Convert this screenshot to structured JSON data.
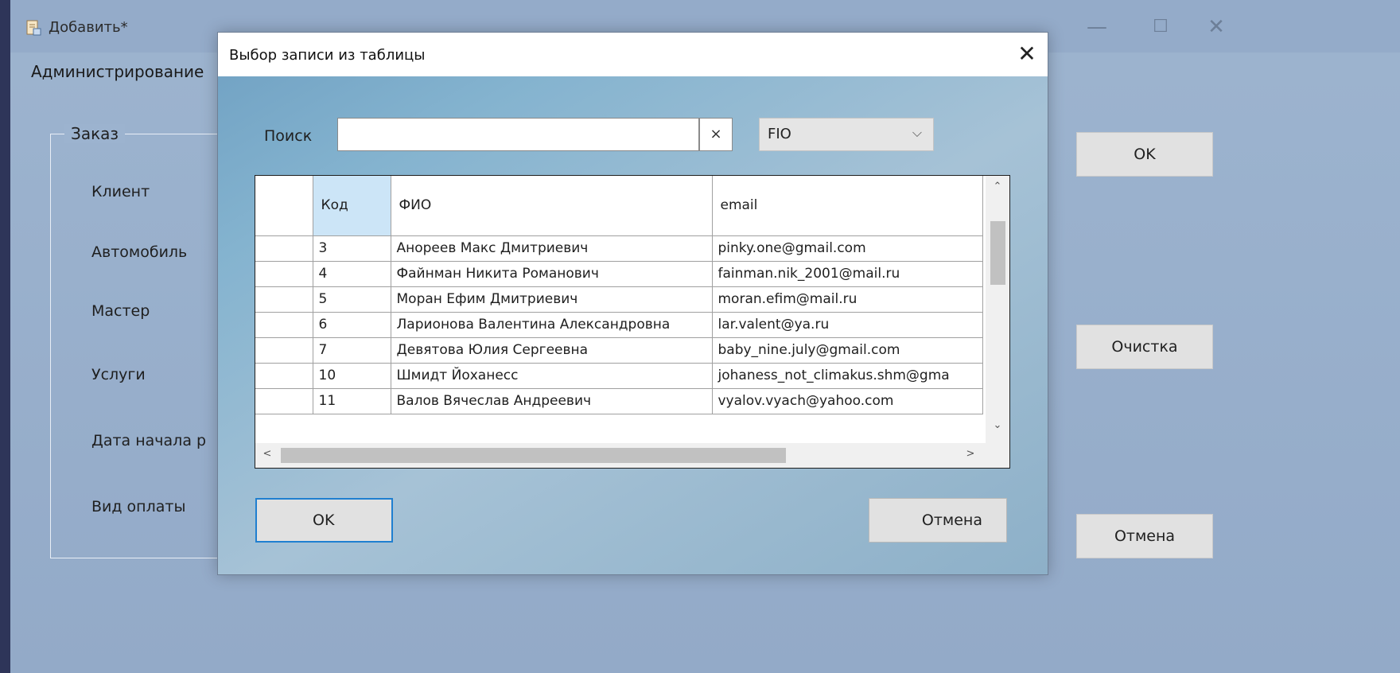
{
  "window": {
    "title": "Добавить*",
    "menu": {
      "admin": "Администрирование"
    },
    "controls": {
      "minimize": "—",
      "maximize": "☐",
      "close": "✕"
    }
  },
  "order_form": {
    "group_title": "Заказ",
    "fields": {
      "client": "Клиент",
      "car": "Автомобиль",
      "master": "Мастер",
      "services": "Услуги",
      "start_date": "Дата начала р",
      "payment": "Вид оплаты"
    },
    "buttons": {
      "ok": "OK",
      "clear": "Очистка",
      "cancel": "Отмена"
    }
  },
  "dialog": {
    "title": "Выбор записи из таблицы",
    "close": "✕",
    "search": {
      "label": "Поиск",
      "value": "",
      "clear": "×",
      "field": "FIO",
      "chevron": "⌵"
    },
    "grid": {
      "columns": {
        "code": "Код",
        "fio": "ФИО",
        "email": "email"
      },
      "rows": [
        {
          "code": "3",
          "fio": "Анореев Макс Дмитриевич",
          "email": "pinky.one@gmail.com"
        },
        {
          "code": "4",
          "fio": "Файнман Никита Романович",
          "email": "fainman.nik_2001@mail.ru"
        },
        {
          "code": "5",
          "fio": "Моран Ефим Дмитриевич",
          "email": "moran.efim@mail.ru"
        },
        {
          "code": "6",
          "fio": "Ларионова Валентина Александровна",
          "email": "lar.valent@ya.ru"
        },
        {
          "code": "7",
          "fio": "Девятова Юлия Сергеевна",
          "email": "baby_nine.july@gmail.com"
        },
        {
          "code": "10",
          "fio": "Шмидт Йоханесс",
          "email": "johaness_not_climakus.shm@gma"
        },
        {
          "code": "11",
          "fio": "Валов Вячеслав Андреевич",
          "email": "vyalov.vyach@yahoo.com"
        }
      ],
      "scroll": {
        "up": "⌃",
        "down": "⌄",
        "left": "<",
        "right": ">"
      }
    },
    "buttons": {
      "ok": "OK",
      "cancel": "Отмена"
    }
  }
}
